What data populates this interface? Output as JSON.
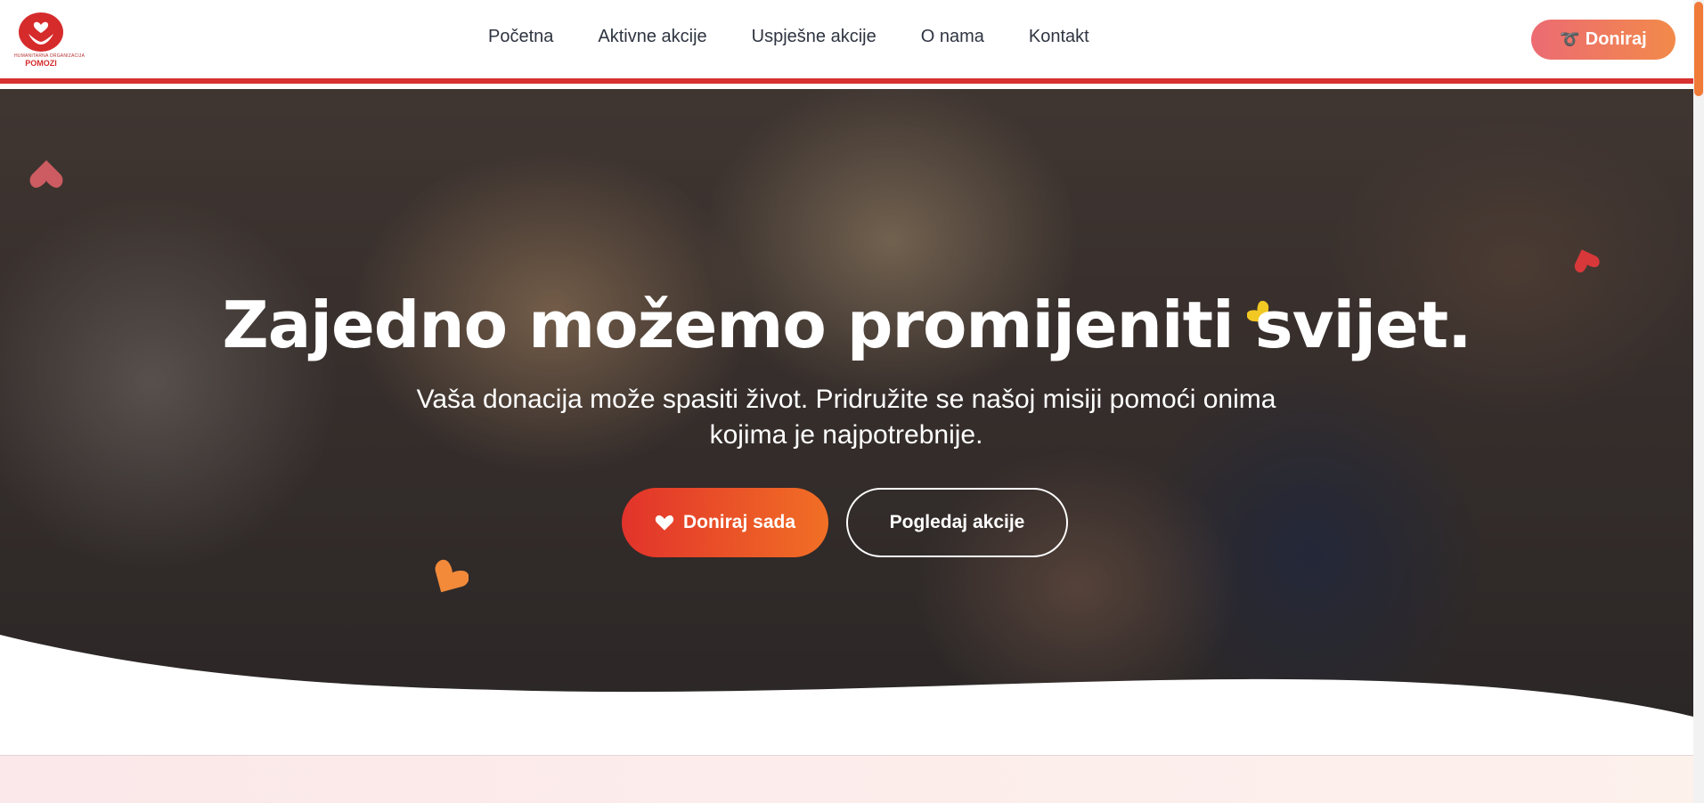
{
  "brand": {
    "logo_sub": "HUMANITARNA ORGANIZACIJA",
    "logo_name": "POMOZI"
  },
  "nav": {
    "items": [
      "Početna",
      "Aktivne akcije",
      "Uspješne akcije",
      "O nama",
      "Kontakt"
    ]
  },
  "header": {
    "donate_label": "Doniraj",
    "donate_icon": "ribbon-icon"
  },
  "hero": {
    "title": "Zajedno možemo promijeniti svijet.",
    "subtitle": "Vaša donacija može spasiti život. Pridružite se našoj misiji pomoći onima kojima je najpotrebnije.",
    "primary_button": "Doniraj sada",
    "primary_icon": "heart-icon",
    "secondary_button": "Pogledaj akcije"
  },
  "colors": {
    "accent_red": "#d7322f",
    "accent_orange": "#f16f25",
    "donate_gradient_start": "#ec6b73",
    "donate_gradient_end": "#f28a4a"
  }
}
